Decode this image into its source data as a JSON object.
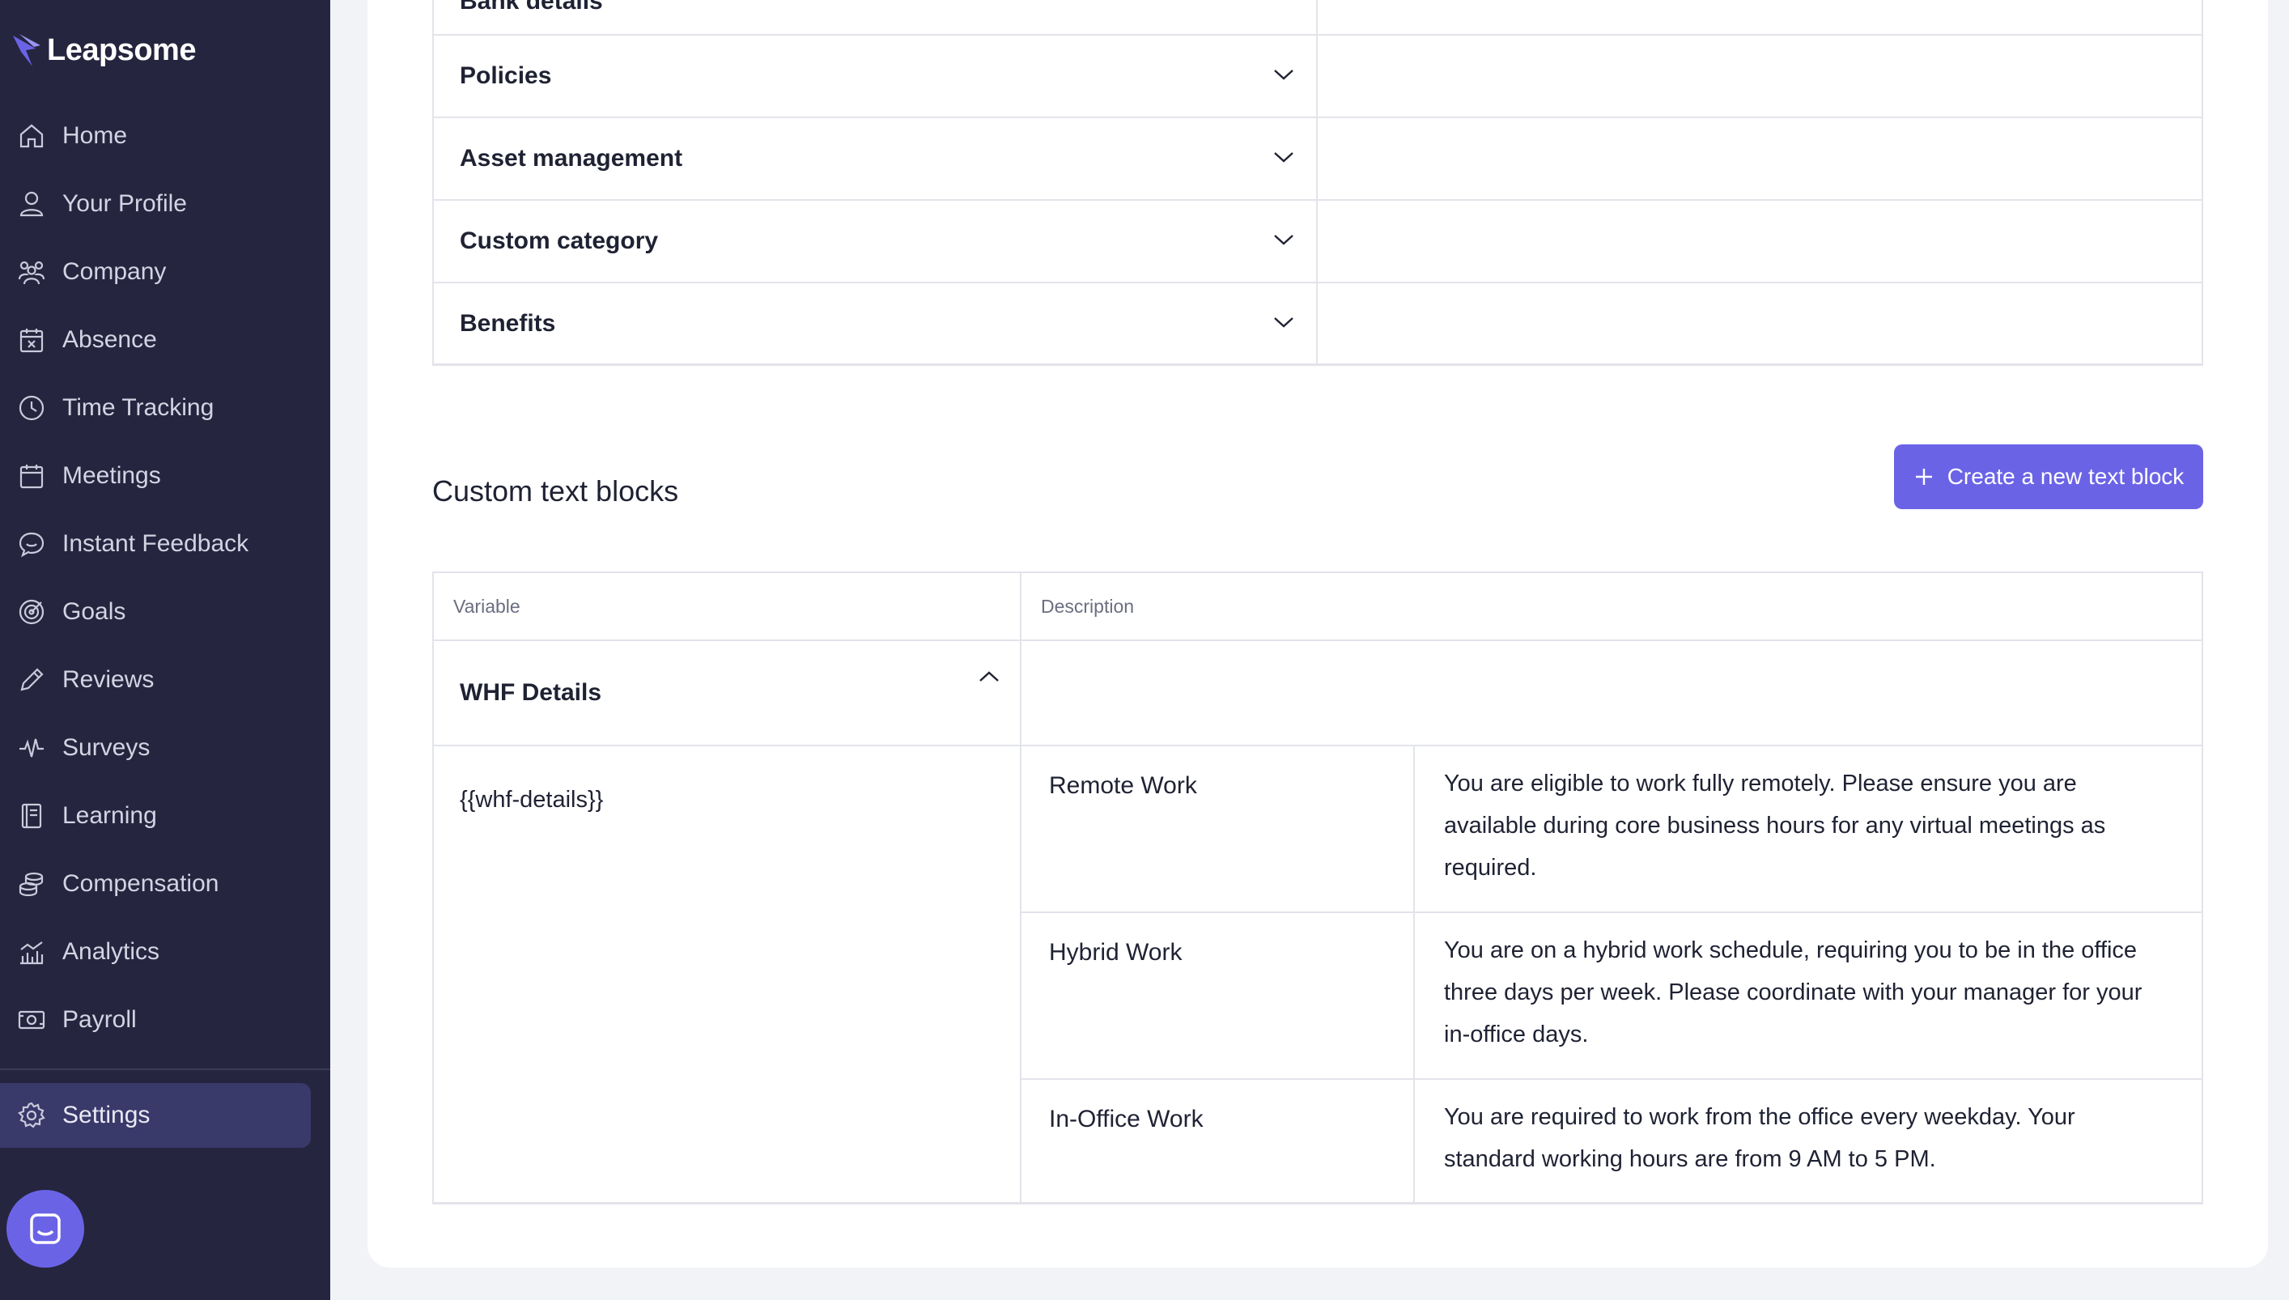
{
  "sidebar": {
    "brand": "Leapsome",
    "items": [
      {
        "label": "Home",
        "icon": "home-icon"
      },
      {
        "label": "Your Profile",
        "icon": "user-icon"
      },
      {
        "label": "Company",
        "icon": "people-icon"
      },
      {
        "label": "Absence",
        "icon": "calendar-x-icon"
      },
      {
        "label": "Time Tracking",
        "icon": "clock-icon"
      },
      {
        "label": "Meetings",
        "icon": "calendar-icon"
      },
      {
        "label": "Instant Feedback",
        "icon": "chat-bubble-icon"
      },
      {
        "label": "Goals",
        "icon": "target-icon"
      },
      {
        "label": "Reviews",
        "icon": "pencil-icon"
      },
      {
        "label": "Surveys",
        "icon": "pulse-icon"
      },
      {
        "label": "Learning",
        "icon": "book-icon"
      },
      {
        "label": "Compensation",
        "icon": "coins-icon"
      },
      {
        "label": "Analytics",
        "icon": "chart-icon"
      },
      {
        "label": "Payroll",
        "icon": "money-icon"
      }
    ],
    "settings": {
      "label": "Settings",
      "icon": "gear-icon"
    }
  },
  "categories": [
    {
      "label": "Bank details"
    },
    {
      "label": "Policies"
    },
    {
      "label": "Asset management"
    },
    {
      "label": "Custom category"
    },
    {
      "label": "Benefits"
    }
  ],
  "custom_text_blocks": {
    "title": "Custom text blocks",
    "create_button": "Create a new text block",
    "columns": {
      "variable": "Variable",
      "description": "Description"
    },
    "block": {
      "name": "WHF Details",
      "variable": "{{whf-details}}",
      "options": [
        {
          "name": "Remote Work",
          "description": "You are eligible to work fully remotely. Please ensure you are available during core business hours for any virtual meetings as required."
        },
        {
          "name": "Hybrid Work",
          "description": "You are on a hybrid work schedule, requiring you to be in the office three days per week. Please coordinate with your manager for your in-office days."
        },
        {
          "name": "In-Office Work",
          "description": "You are required to work from the office every weekday. Your standard working hours are from 9 AM to 5 PM."
        }
      ]
    }
  },
  "colors": {
    "sidebar_bg": "#25253f",
    "sidebar_active": "#39396a",
    "accent": "#6b63e6",
    "border": "#e3e4ea"
  }
}
